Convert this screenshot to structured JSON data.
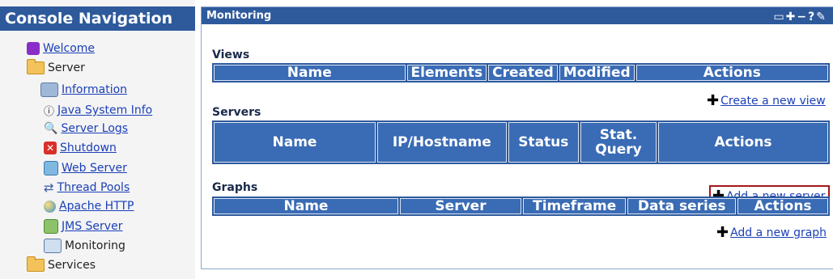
{
  "nav": {
    "title": "Console Navigation",
    "items": [
      {
        "label": "Welcome"
      },
      {
        "label": "Server"
      },
      {
        "label": "Information"
      },
      {
        "label": "Java System Info"
      },
      {
        "label": "Server Logs"
      },
      {
        "label": "Shutdown"
      },
      {
        "label": "Web Server"
      },
      {
        "label": "Thread Pools"
      },
      {
        "label": "Apache HTTP"
      },
      {
        "label": "JMS Server"
      },
      {
        "label": "Monitoring"
      },
      {
        "label": "Services"
      }
    ]
  },
  "panel": {
    "title": "Monitoring",
    "tools": "▭✚−?✎"
  },
  "views": {
    "title": "Views",
    "columns": [
      "Name",
      "Elements",
      "Created",
      "Modified",
      "Actions"
    ],
    "add_link": "Create a new view"
  },
  "servers": {
    "title": "Servers",
    "columns": [
      "Name",
      "IP/Hostname",
      "Status",
      "Stat. Query",
      "Actions"
    ],
    "add_link": "Add a new server"
  },
  "graphs": {
    "title": "Graphs",
    "columns": [
      "Name",
      "Server",
      "Timeframe",
      "Data series",
      "Actions"
    ],
    "add_link": "Add a new graph"
  },
  "colors": {
    "header": "#2e5a9c",
    "table_header": "#3a6bb5",
    "link": "#1a3fb8",
    "highlight": "#a4161a"
  }
}
